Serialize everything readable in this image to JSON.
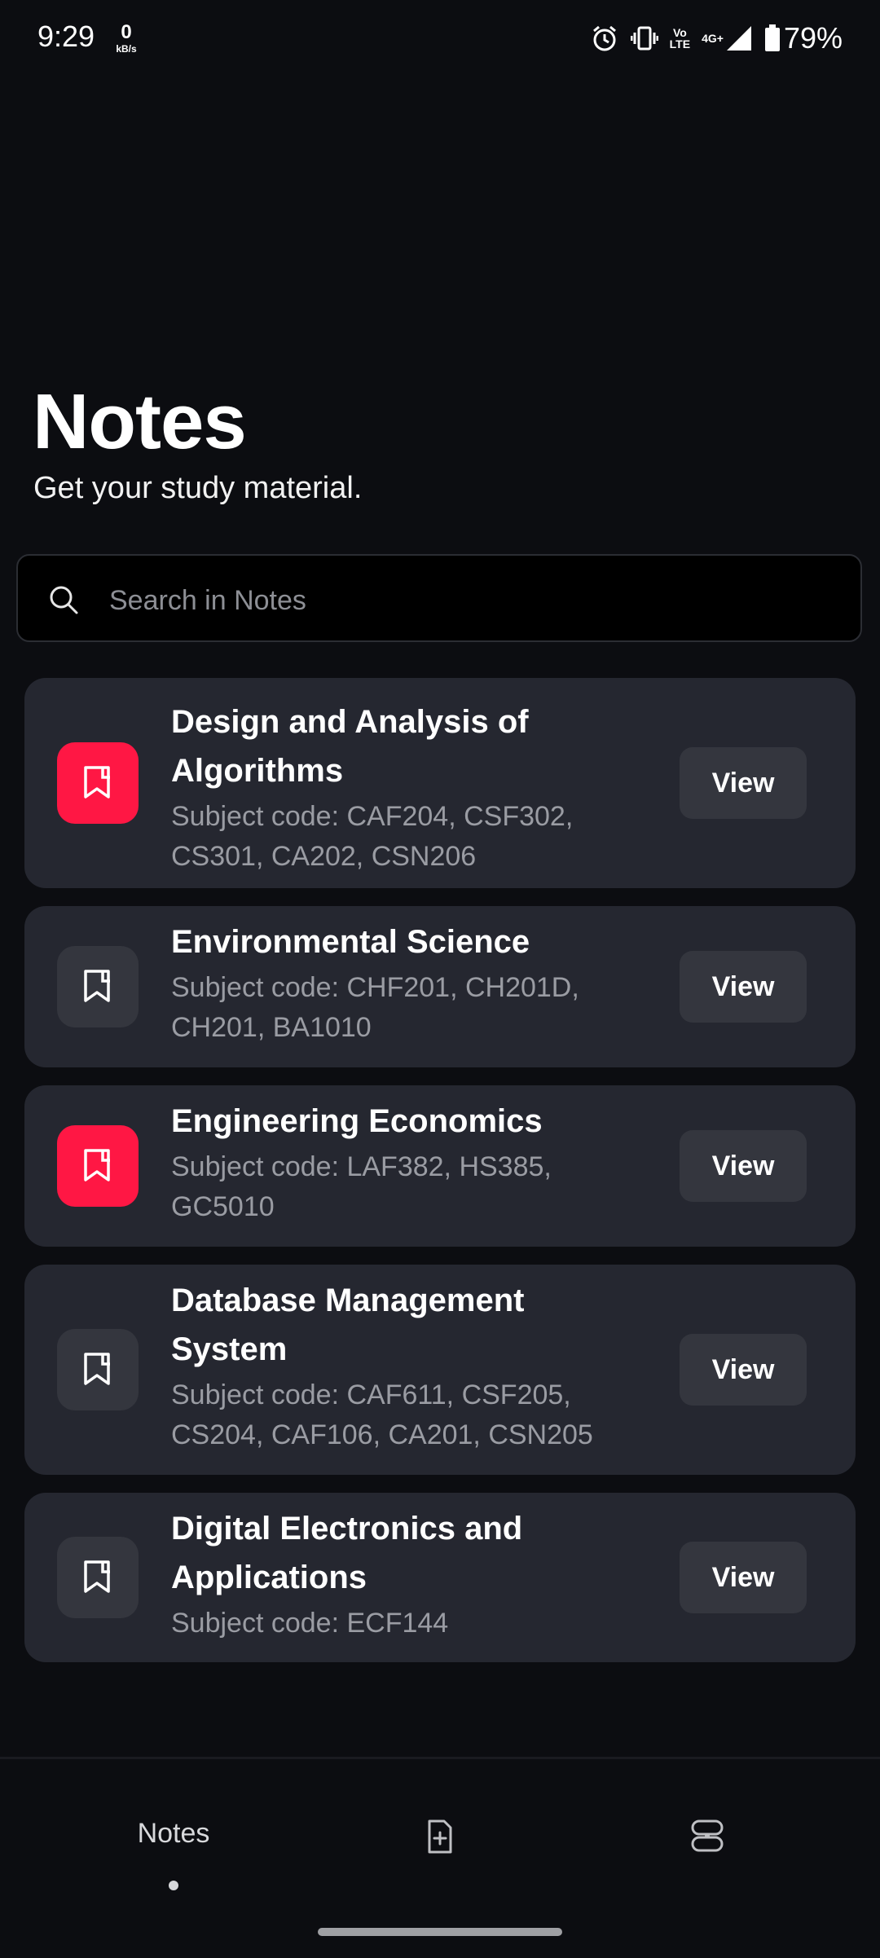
{
  "status_bar": {
    "time": "9:29",
    "net_speed": "0",
    "net_speed_unit": "kB/s",
    "volte_top": "Vo",
    "volte_bottom": "LTE",
    "network": "4G+",
    "battery": "79%",
    "icons": [
      "alarm-icon",
      "vibrate-icon",
      "volte-icon",
      "signal-icon",
      "battery-icon"
    ]
  },
  "header": {
    "title": "Notes",
    "subtitle": "Get your study material."
  },
  "search": {
    "placeholder": "Search in Notes",
    "value": ""
  },
  "colors": {
    "background": "#0c0d11",
    "card": "#252730",
    "accent": "#ff1744",
    "button": "#34363e",
    "muted_text": "#9a9ca3"
  },
  "subjects": [
    {
      "title_lines": [
        "Design and Analysis of",
        "Algorithms"
      ],
      "subtitle_lines": [
        "Subject code: CAF204, CSF302,",
        "CS301, CA202, CSN206"
      ],
      "highlighted": true,
      "button": "View"
    },
    {
      "title_lines": [
        "Environmental Science"
      ],
      "subtitle_lines": [
        "Subject code: CHF201, CH201D,",
        "CH201, BA1010"
      ],
      "highlighted": false,
      "button": "View"
    },
    {
      "title_lines": [
        "Engineering Economics"
      ],
      "subtitle_lines": [
        "Subject code: LAF382, HS385,",
        "GC5010"
      ],
      "highlighted": true,
      "button": "View"
    },
    {
      "title_lines": [
        "Database Management",
        "System"
      ],
      "subtitle_lines": [
        "Subject code: CAF611, CSF205,",
        "CS204, CAF106, CA201, CSN205"
      ],
      "highlighted": false,
      "button": "View"
    },
    {
      "title_lines": [
        "Digital Electronics and",
        "Applications"
      ],
      "subtitle_lines": [
        "Subject code: ECF144"
      ],
      "highlighted": false,
      "button": "View"
    }
  ],
  "bottom_nav": {
    "notes_label": "Notes",
    "active": "notes",
    "items": [
      "notes",
      "upload-file-icon",
      "apps-icon"
    ]
  }
}
